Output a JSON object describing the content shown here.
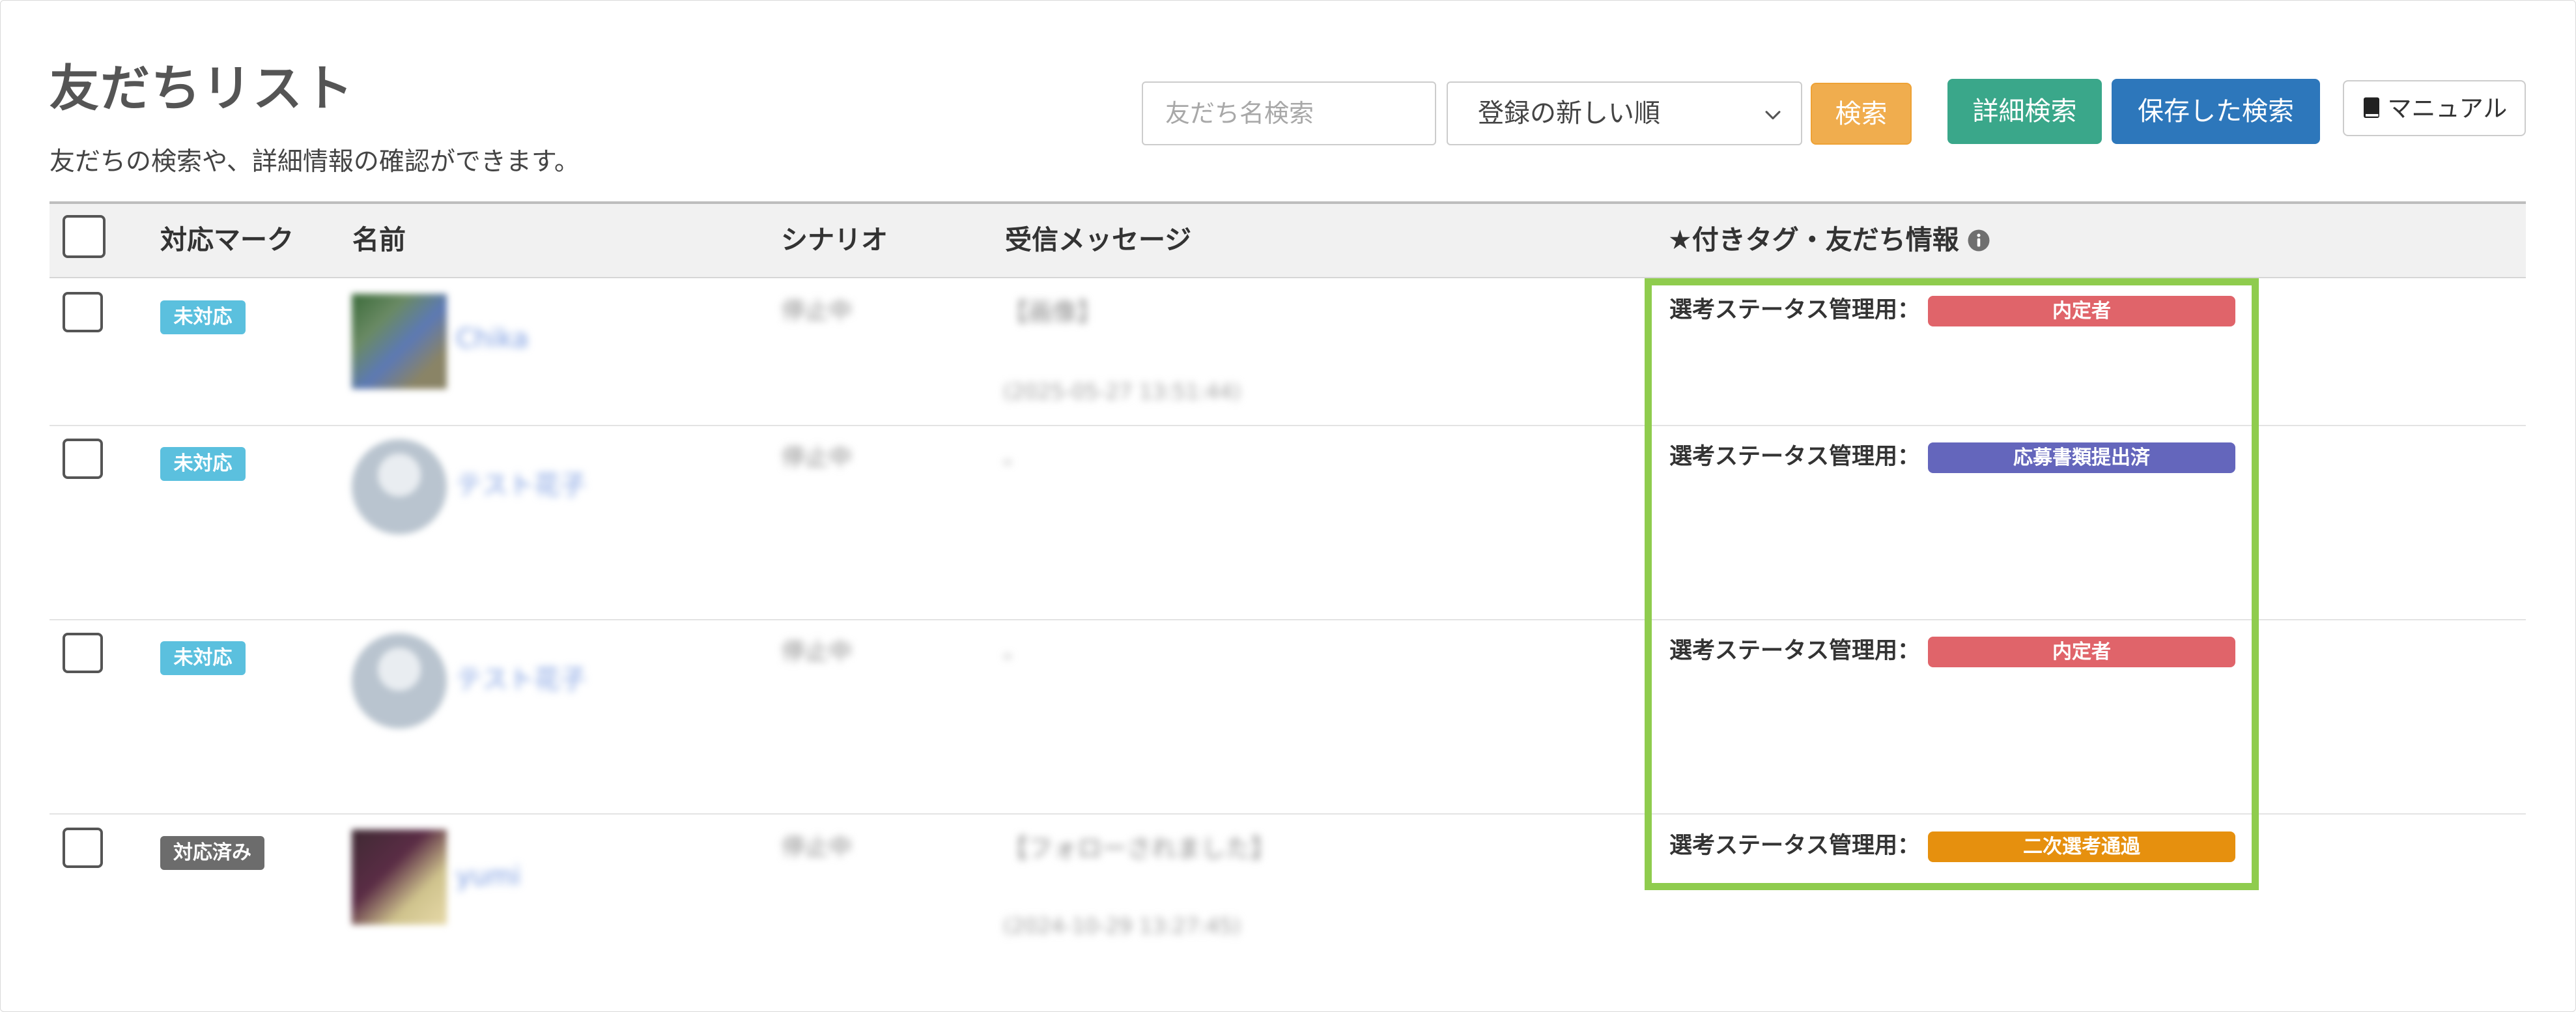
{
  "page": {
    "title": "友だちリスト",
    "subtitle": "友だちの検索や、詳細情報の確認ができます。"
  },
  "toolbar": {
    "search_placeholder": "友だち名検索",
    "search_value": "",
    "sort_selected": "登録の新しい順",
    "search_button": "検索",
    "advanced_search_button": "詳細検索",
    "saved_search_button": "保存した検索",
    "manual_button": "マニュアル"
  },
  "table": {
    "headers": {
      "mark": "対応マーク",
      "name": "名前",
      "scenario": "シナリオ",
      "message": "受信メッセージ",
      "tag": "★付きタグ・友だち情報"
    },
    "rows": [
      {
        "mark": "未対応",
        "mark_status": "pending",
        "name": "Chika",
        "scenario": "停止中",
        "message": "【画像】",
        "message_time": "(2025-05-27 13:51:44)",
        "tag_label": "選考ステータス管理用：",
        "tag": "内定者",
        "tag_color": "#e0646a"
      },
      {
        "mark": "未対応",
        "mark_status": "pending",
        "name": "テスト花子",
        "scenario": "停止中",
        "message": "-",
        "message_time": "",
        "tag_label": "選考ステータス管理用：",
        "tag": "応募書類提出済",
        "tag_color": "#6466bc"
      },
      {
        "mark": "未対応",
        "mark_status": "pending",
        "name": "テスト花子",
        "scenario": "停止中",
        "message": "-",
        "message_time": "",
        "tag_label": "選考ステータス管理用：",
        "tag": "内定者",
        "tag_color": "#e0646a"
      },
      {
        "mark": "対応済み",
        "mark_status": "done",
        "name": "yumi",
        "scenario": "停止中",
        "message": "【フォローされました】",
        "message_time": "(2024-10-29 13:27:45)",
        "tag_label": "選考ステータス管理用：",
        "tag": "二次選考通過",
        "tag_color": "#e6900e"
      }
    ]
  },
  "colors": {
    "highlight": "#8fcc4e",
    "search_button": "#f0ad4e",
    "advanced_search": "#3aa78a",
    "saved_search": "#2d77bb",
    "badge_pending": "#5bc0de",
    "badge_done": "#6c6c6c"
  },
  "icons": [
    "chevron-down-icon",
    "book-icon",
    "info-icon"
  ]
}
